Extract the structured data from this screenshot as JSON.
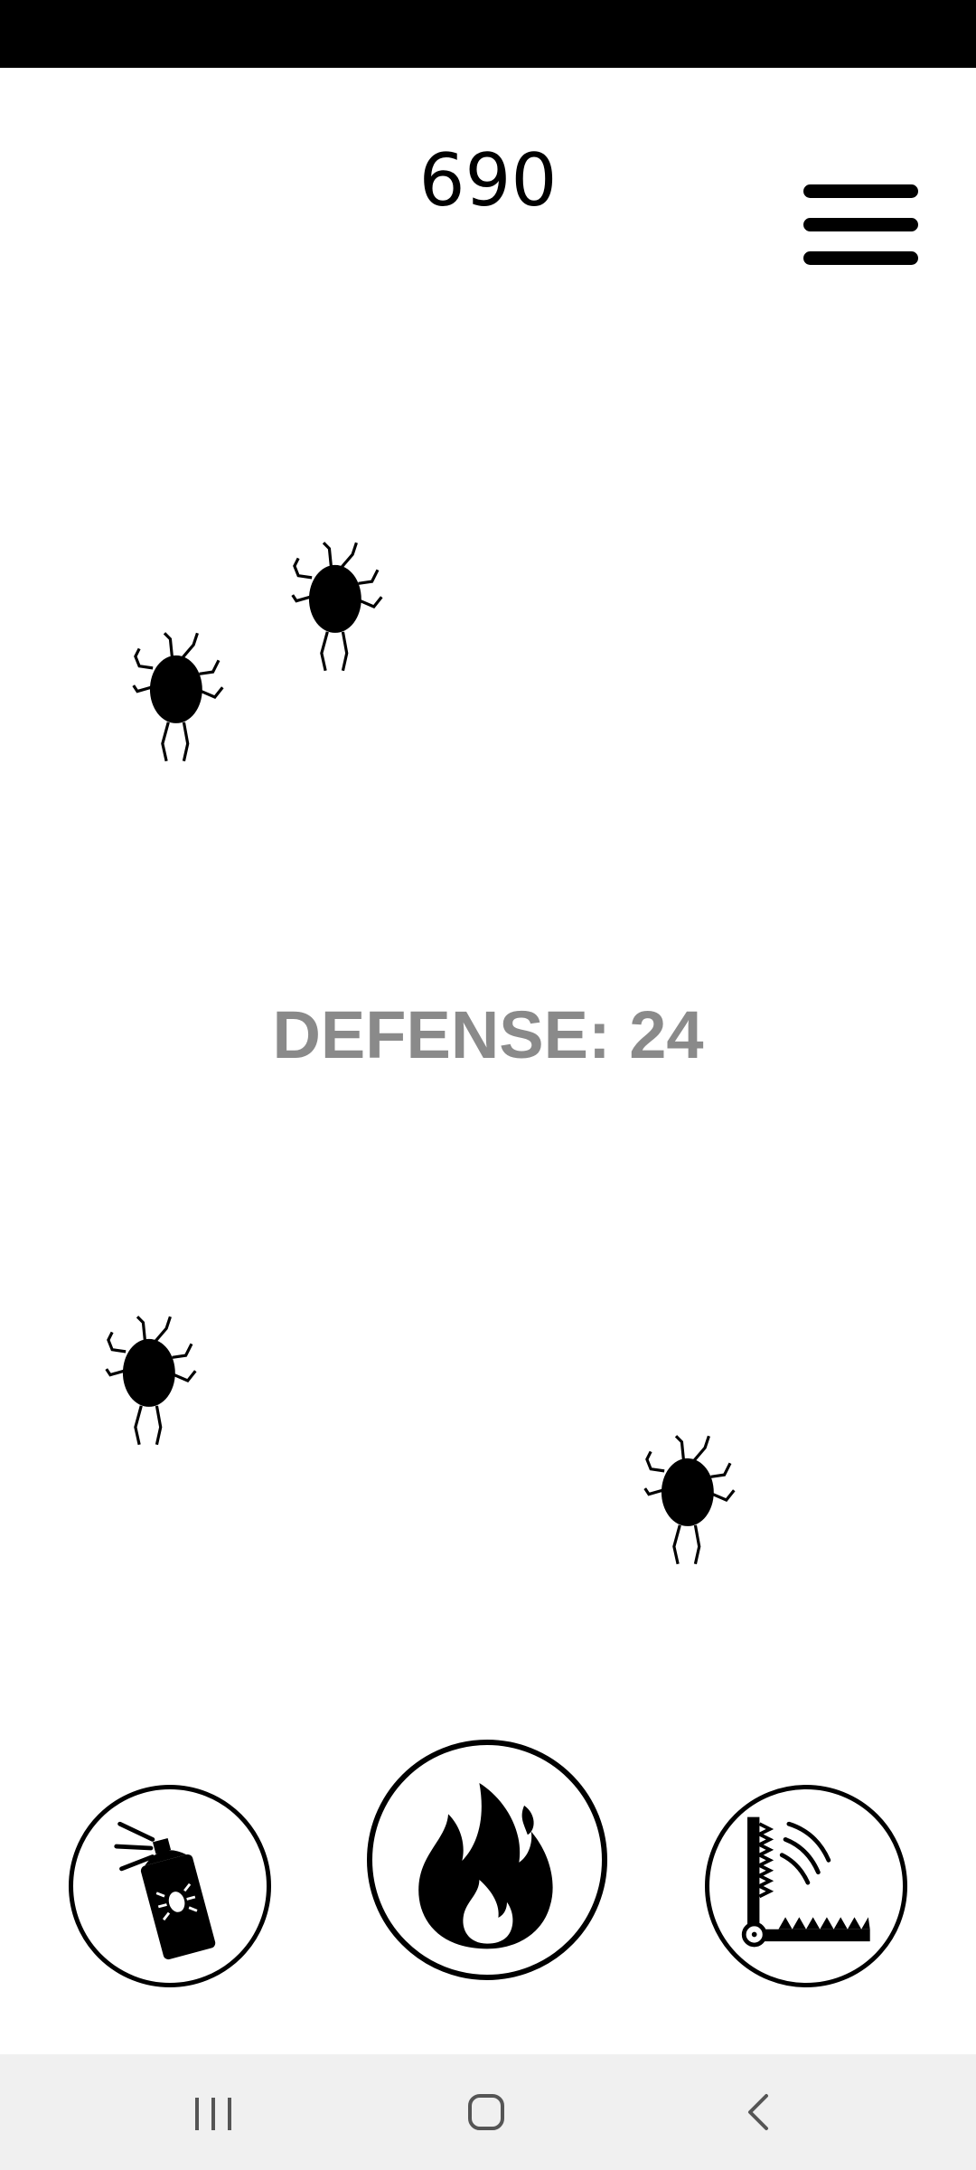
{
  "hud": {
    "score": "690",
    "menu_icon": "hamburger-menu-icon"
  },
  "defense": {
    "label": "DEFENSE: 24"
  },
  "bugs": {
    "count": 4,
    "icon": "beetle-icon"
  },
  "tools": [
    {
      "id": "spray",
      "icon": "bug-spray-icon"
    },
    {
      "id": "fire",
      "icon": "fire-icon"
    },
    {
      "id": "trap",
      "icon": "bug-trap-icon"
    }
  ],
  "navigation": {
    "recent_icon": "recent-apps-icon",
    "home_icon": "home-icon",
    "back_icon": "back-icon"
  },
  "colors": {
    "status_bar": "#000000",
    "background": "#ffffff",
    "defense_text": "#8a8a8a",
    "nav_bar": "#f0f0f0"
  }
}
